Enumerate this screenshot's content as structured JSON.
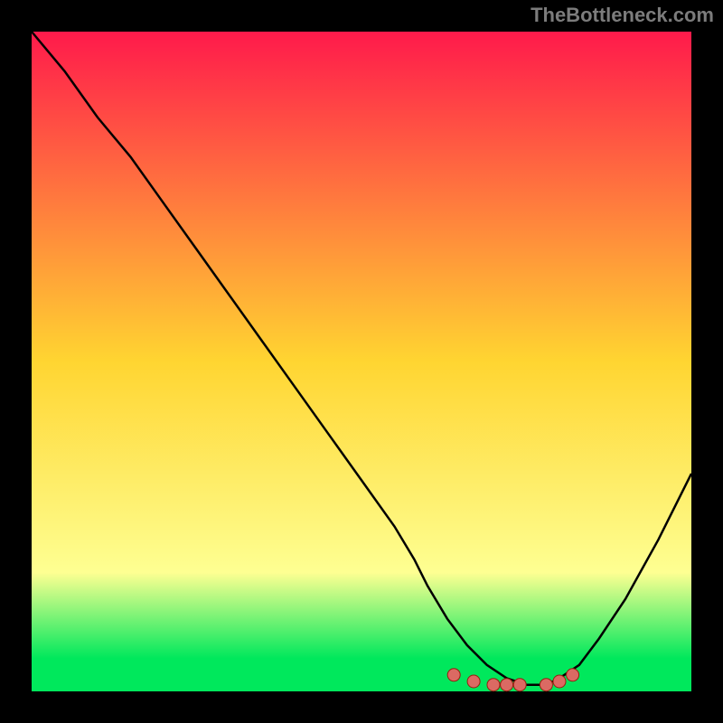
{
  "watermark": "TheBottleneck.com",
  "colors": {
    "black": "#000000",
    "curve": "#000000",
    "marker_fill": "#db6a63",
    "marker_stroke": "#971f0f",
    "grad_top": "#ff1a4b",
    "grad_mid": "#ffd531",
    "grad_pale": "#feff92",
    "grad_green": "#00e85c"
  },
  "chart_data": {
    "type": "line",
    "title": "",
    "xlabel": "",
    "ylabel": "",
    "xlim": [
      0,
      100
    ],
    "ylim": [
      0,
      100
    ],
    "series": [
      {
        "name": "bottleneck-curve",
        "x": [
          0,
          5,
          10,
          15,
          20,
          25,
          30,
          35,
          40,
          45,
          50,
          55,
          58,
          60,
          63,
          66,
          69,
          72,
          75,
          78,
          80,
          83,
          86,
          90,
          95,
          100
        ],
        "values": [
          100,
          94,
          87,
          81,
          74,
          67,
          60,
          53,
          46,
          39,
          32,
          25,
          20,
          16,
          11,
          7,
          4,
          2,
          1,
          1,
          2,
          4,
          8,
          14,
          23,
          33
        ]
      }
    ],
    "markers": {
      "name": "highlighted-region",
      "x": [
        64,
        67,
        70,
        72,
        74,
        78,
        80,
        82
      ],
      "values": [
        2.5,
        1.5,
        1.0,
        1.0,
        1.0,
        1.0,
        1.5,
        2.5
      ]
    },
    "background_gradient": {
      "type": "vertical",
      "stops": [
        {
          "offset": 0.0,
          "color": "#ff1a4b"
        },
        {
          "offset": 0.5,
          "color": "#ffd531"
        },
        {
          "offset": 0.82,
          "color": "#feff92"
        },
        {
          "offset": 0.95,
          "color": "#00e85c"
        },
        {
          "offset": 1.0,
          "color": "#00e85c"
        }
      ]
    }
  }
}
